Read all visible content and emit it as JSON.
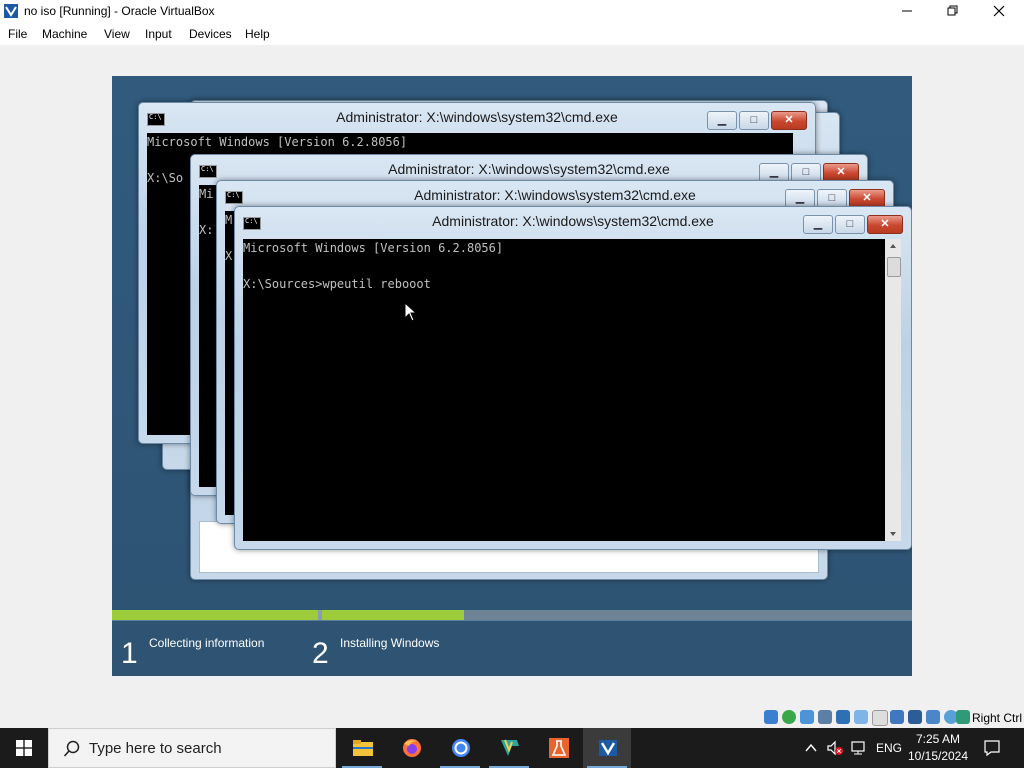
{
  "window": {
    "title": "no iso [Running] - Oracle VirtualBox",
    "minimize_label": "—",
    "restore_label": "❐",
    "close_label": "✕"
  },
  "menubar": {
    "items": [
      "File",
      "Machine",
      "View",
      "Input",
      "Devices",
      "Help"
    ]
  },
  "guest": {
    "windows": [
      {
        "title": "Administrator: X:\\windows\\system32\\cmd.exe",
        "lines": "Microsoft Windows [Version 6.2.8056]\n\nX:\\So"
      },
      {
        "title": "Administrator: X:\\windows\\system32\\cmd.exe",
        "lines": "Mi\n\nX:"
      },
      {
        "title": "Administrator: X:\\windows\\system32\\cmd.exe",
        "lines": "M\n\nX"
      },
      {
        "title": "Administrator: X:\\windows\\system32\\cmd.exe",
        "lines": "Microsoft Windows [Version 6.2.8056]\n\nX:\\Sources>wpeutil rebooot"
      }
    ],
    "setup_steps": [
      {
        "number": "1",
        "label": "Collecting information"
      },
      {
        "number": "2",
        "label": "Installing Windows"
      }
    ],
    "progress": {
      "step1_fraction": 1.0,
      "step2_fraction": 0.24
    }
  },
  "statusbar": {
    "host_key": "Right Ctrl",
    "icons": [
      "hard-disk-icon",
      "optical-drive-icon",
      "audio-icon",
      "network-icon",
      "usb-icon",
      "shared-folders-icon",
      "display-icon",
      "video-capture-icon",
      "recording-icon",
      "cpu-icon",
      "mouse-integration-icon"
    ]
  },
  "taskbar": {
    "search_placeholder": "Type here to search",
    "apps": [
      "file-explorer-icon",
      "firefox-icon",
      "chrome-icon",
      "virtualbox-manager-icon",
      "lab-flask-icon",
      "virtualbox-vm-icon"
    ],
    "language": "ENG",
    "time": "7:25 AM",
    "date": "10/15/2024"
  },
  "colors": {
    "guest_bg": "#2f5575",
    "progress_done": "#9ccc3a",
    "progress_todo": "#8a9cae",
    "taskbar_bg": "#1b1b1b"
  }
}
